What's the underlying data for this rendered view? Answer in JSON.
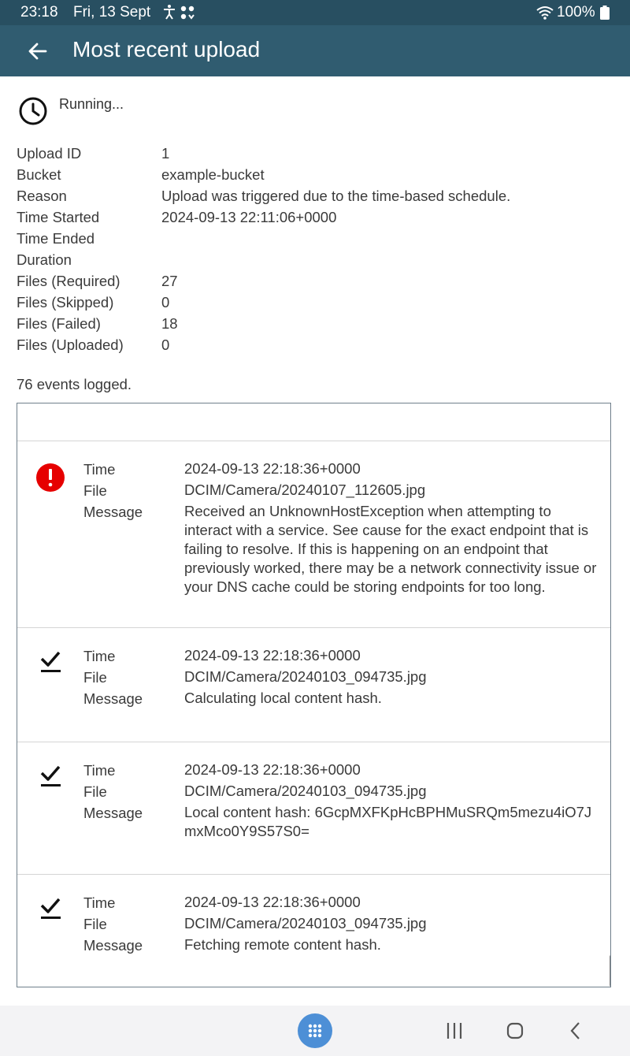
{
  "status_bar": {
    "time": "23:18",
    "date": "Fri, 13 Sept",
    "battery": "100%",
    "icons": [
      "accessibility-icon",
      "notification-icon",
      "wifi-icon",
      "battery-icon"
    ]
  },
  "app_bar": {
    "title": "Most recent upload",
    "back_icon": "arrow-left-icon"
  },
  "upload": {
    "state": "Running...",
    "details": [
      {
        "label": "Upload ID",
        "value": "1"
      },
      {
        "label": "Bucket",
        "value": "example-bucket"
      },
      {
        "label": "Reason",
        "value": "Upload was triggered due to the time-based schedule."
      },
      {
        "label": "Time Started",
        "value": "2024-09-13 22:11:06+0000"
      },
      {
        "label": "Time Ended",
        "value": ""
      },
      {
        "label": "Duration",
        "value": ""
      },
      {
        "label": "Files (Required)",
        "value": "27"
      },
      {
        "label": "Files (Skipped)",
        "value": "0"
      },
      {
        "label": "Files (Failed)",
        "value": "18"
      },
      {
        "label": "Files (Uploaded)",
        "value": "0"
      }
    ],
    "events_logged": "76 events logged."
  },
  "events": {
    "labels": {
      "time": "Time",
      "file": "File",
      "message": "Message"
    },
    "items": [
      {
        "type": "error",
        "icon": "error-icon",
        "time": "2024-09-13 22:18:36+0000",
        "file": "DCIM/Camera/20240107_112605.jpg",
        "message": "Received an UnknownHostException when attempting to interact with a service. See cause for the exact endpoint that is failing to resolve. If this is happening on an endpoint that previously worked, there may be a network connectivity issue or your DNS cache could be storing endpoints for too long."
      },
      {
        "type": "success",
        "icon": "check-icon",
        "time": "2024-09-13 22:18:36+0000",
        "file": "DCIM/Camera/20240103_094735.jpg",
        "message": "Calculating local content hash."
      },
      {
        "type": "success",
        "icon": "check-icon",
        "time": "2024-09-13 22:18:36+0000",
        "file": "DCIM/Camera/20240103_094735.jpg",
        "message": "Local content hash: 6GcpMXFKpHcBPHMuSRQm5mezu4iO7JmxMco0Y9S57S0="
      },
      {
        "type": "success",
        "icon": "check-icon",
        "time": "2024-09-13 22:18:36+0000",
        "file": "DCIM/Camera/20240103_094735.jpg",
        "message": "Fetching remote content hash."
      }
    ]
  },
  "colors": {
    "status_bar": "#284f61",
    "app_bar": "#305c70",
    "error": "#e60000",
    "apps_button": "#4d8fd6"
  },
  "nav_bar": {
    "icons": [
      "apps-grid-icon",
      "recents-icon",
      "home-icon",
      "chevron-left-icon"
    ]
  }
}
